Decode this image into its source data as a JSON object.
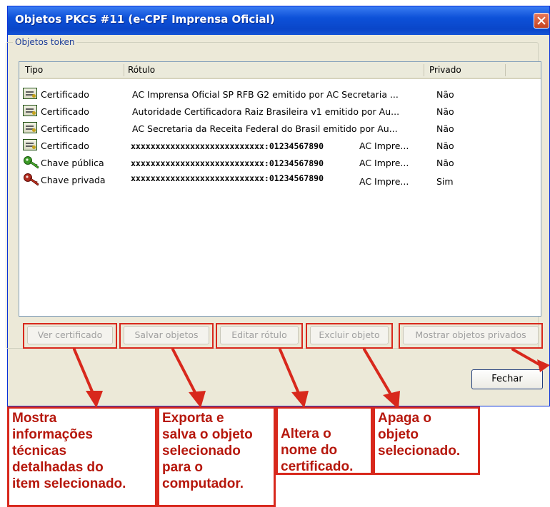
{
  "window": {
    "title": "Objetos PKCS #11 (e-CPF Imprensa Oficial)"
  },
  "group": {
    "label": "Objetos token"
  },
  "table": {
    "columns": [
      "Tipo",
      "Rótulo",
      "Privado"
    ],
    "rows": [
      {
        "icon": "certificate-icon",
        "tipo": "Certificado",
        "rotulo": "AC Imprensa Oficial SP RFB G2 emitido por AC Secretaria ...",
        "rotulo_suffix": "",
        "privado": "Não"
      },
      {
        "icon": "certificate-icon",
        "tipo": "Certificado",
        "rotulo": "Autoridade Certificadora Raiz Brasileira v1 emitido por Au...",
        "rotulo_suffix": "",
        "privado": "Não"
      },
      {
        "icon": "certificate-icon",
        "tipo": "Certificado",
        "rotulo": "AC Secretaria da Receita Federal do Brasil emitido por Au...",
        "rotulo_suffix": "",
        "privado": "Não"
      },
      {
        "icon": "certificate-icon",
        "tipo": "Certificado",
        "rotulo": "xxxxxxxxxxxxxxxxxxxxxxxxxxx:01234567890",
        "rotulo_suffix": "AC Impre...",
        "privado": "Não"
      },
      {
        "icon": "public-key-icon",
        "tipo": "Chave pública",
        "rotulo": "xxxxxxxxxxxxxxxxxxxxxxxxxxx:01234567890",
        "rotulo_suffix": "AC Impre...",
        "privado": "Não"
      },
      {
        "icon": "private-key-icon",
        "tipo": "Chave privada",
        "rotulo": "xxxxxxxxxxxxxxxxxxxxxxxxxxx:01234567890",
        "rotulo_suffix": "AC Impre...",
        "privado": "Sim"
      }
    ]
  },
  "buttons": {
    "ver_certificado": "Ver certificado",
    "salvar_objetos": "Salvar objetos",
    "editar_rotulo": "Editar rótulo",
    "excluir_objeto": "Excluir objeto",
    "mostrar_privados": "Mostrar objetos privados",
    "fechar": "Fechar"
  },
  "annotations": [
    {
      "lines": [
        "Mostra",
        "informações",
        "técnicas",
        "detalhadas do",
        "item selecionado."
      ]
    },
    {
      "lines": [
        "Exporta e",
        "salva o objeto",
        "selecionado",
        "para o",
        "computador."
      ]
    },
    {
      "lines": [
        "Altera o",
        "nome do",
        "certificado."
      ]
    },
    {
      "lines": [
        "Apaga o",
        "objeto",
        "selecionado."
      ]
    }
  ],
  "colors": {
    "titlebar": "#0a46c9",
    "annotation_red": "#d8281c",
    "window_bg": "#ece9d8"
  }
}
